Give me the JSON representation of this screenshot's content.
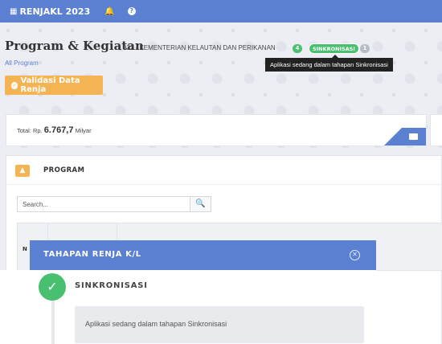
{
  "topbar": {
    "app_title": "RENJAKL 2023",
    "apps_icon": "apps-grid-icon",
    "bell_icon": "bell-icon",
    "help_icon": "help-circle-icon"
  },
  "header": {
    "title": "Program & Kegiatan",
    "ministry": "032 - KEMENTERIAN KELAUTAN DAN PERIKANAN",
    "stage_count": "4",
    "stage_status": "SINKRONISASI",
    "next_stage_count": "1",
    "tooltip": "Aplikasi sedang dalam tahapan Sinkronisasi",
    "breadcrumb": "All Program"
  },
  "validasi_button": {
    "label": "Validasi Data Renja"
  },
  "total": {
    "label": "Total: Rp.",
    "amount": "6.767,7",
    "unit": "Milyar"
  },
  "program": {
    "title": "PROGRAM",
    "search_placeholder": "Search...",
    "table_col1": "N"
  },
  "modal": {
    "title": "TAHAPAN RENJA K/L",
    "step_title": "SINKRONISASI",
    "step_description": "Aplikasi sedang dalam tahapan Sinkronisasi"
  },
  "colors": {
    "primary": "#5b7fd1",
    "success": "#48c06f",
    "warning": "#f5b453"
  }
}
